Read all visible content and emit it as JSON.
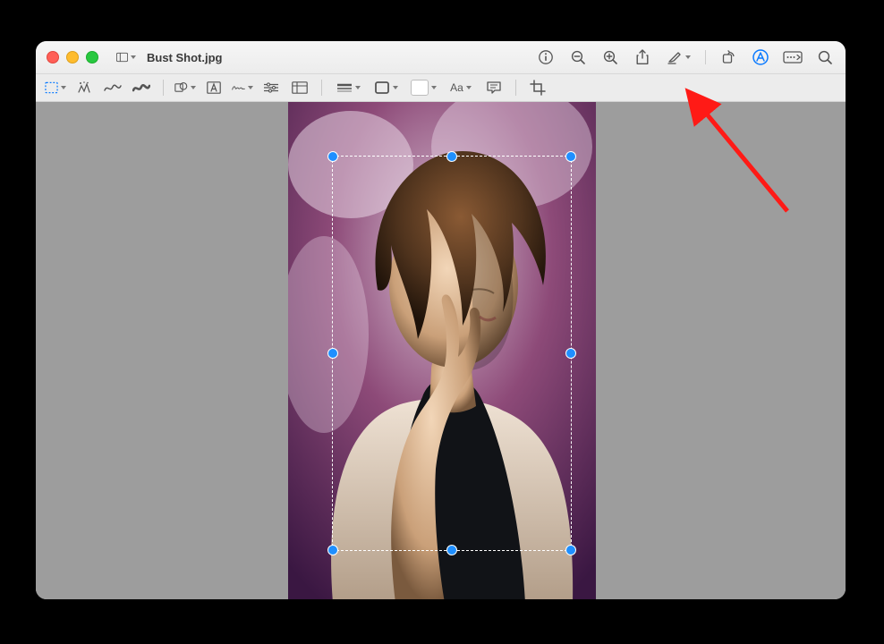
{
  "window": {
    "title": "Bust Shot.jpg"
  },
  "titlebar": {
    "sidebar_button": "Sidebar / Table of Contents",
    "info": "Inspector",
    "zoom_out": "Zoom Out",
    "zoom_in": "Zoom In",
    "share": "Share",
    "highlight": "Highlight",
    "rotate": "Rotate Left",
    "markup_toggle": "Show Markup Toolbar",
    "form_fill": "Form Filling",
    "search": "Search"
  },
  "markup": {
    "selection_tool": "Rectangular Selection",
    "instant_alpha": "Instant Alpha",
    "sketch": "Sketch",
    "draw": "Draw",
    "shapes": "Shapes",
    "text": "Text",
    "sign": "Sign",
    "adjust_color": "Adjust Color",
    "adjust_size": "Adjust Size",
    "border_style": "Shape Style",
    "border_color": "Border Color",
    "fill_color": "Fill Color",
    "text_style_label": "Aa",
    "text_style": "Text Style",
    "annotate": "Image Description",
    "crop": "Crop"
  },
  "annotation": {
    "arrow_points_to": "crop"
  },
  "canvas": {
    "selection_active": true
  }
}
